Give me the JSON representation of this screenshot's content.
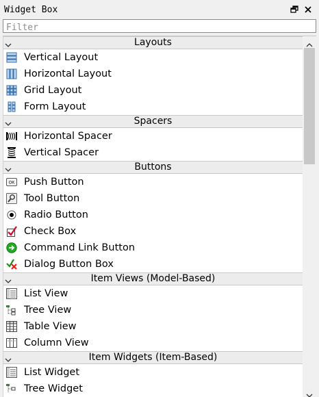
{
  "window": {
    "title": "Widget Box",
    "float_icon": "float-restore-icon",
    "close_icon": "close-icon"
  },
  "filter": {
    "placeholder": "Filter",
    "value": ""
  },
  "categories": [
    {
      "label": "Layouts",
      "expanded": true,
      "items": [
        {
          "label": "Vertical Layout",
          "icon": "vertical-layout-icon"
        },
        {
          "label": "Horizontal Layout",
          "icon": "horizontal-layout-icon"
        },
        {
          "label": "Grid Layout",
          "icon": "grid-layout-icon"
        },
        {
          "label": "Form Layout",
          "icon": "form-layout-icon"
        }
      ]
    },
    {
      "label": "Spacers",
      "expanded": true,
      "items": [
        {
          "label": "Horizontal Spacer",
          "icon": "horizontal-spacer-icon"
        },
        {
          "label": "Vertical Spacer",
          "icon": "vertical-spacer-icon"
        }
      ]
    },
    {
      "label": "Buttons",
      "expanded": true,
      "items": [
        {
          "label": "Push Button",
          "icon": "push-button-icon",
          "icon_text": "OK"
        },
        {
          "label": "Tool Button",
          "icon": "tool-button-icon"
        },
        {
          "label": "Radio Button",
          "icon": "radio-button-icon"
        },
        {
          "label": "Check Box",
          "icon": "check-box-icon"
        },
        {
          "label": "Command Link Button",
          "icon": "command-link-button-icon"
        },
        {
          "label": "Dialog Button Box",
          "icon": "dialog-button-box-icon"
        }
      ]
    },
    {
      "label": "Item Views (Model-Based)",
      "expanded": true,
      "items": [
        {
          "label": "List View",
          "icon": "list-view-icon"
        },
        {
          "label": "Tree View",
          "icon": "tree-view-icon"
        },
        {
          "label": "Table View",
          "icon": "table-view-icon"
        },
        {
          "label": "Column View",
          "icon": "column-view-icon"
        }
      ]
    },
    {
      "label": "Item Widgets (Item-Based)",
      "expanded": true,
      "items": [
        {
          "label": "List Widget",
          "icon": "list-widget-icon"
        },
        {
          "label": "Tree Widget",
          "icon": "tree-widget-icon"
        }
      ]
    }
  ],
  "colors": {
    "category_bg": "#ececec",
    "list_bg": "#ffffff",
    "check_green": "#1f8f1f",
    "command_link_green": "#22aa22",
    "cancel_red": "#e02020"
  }
}
